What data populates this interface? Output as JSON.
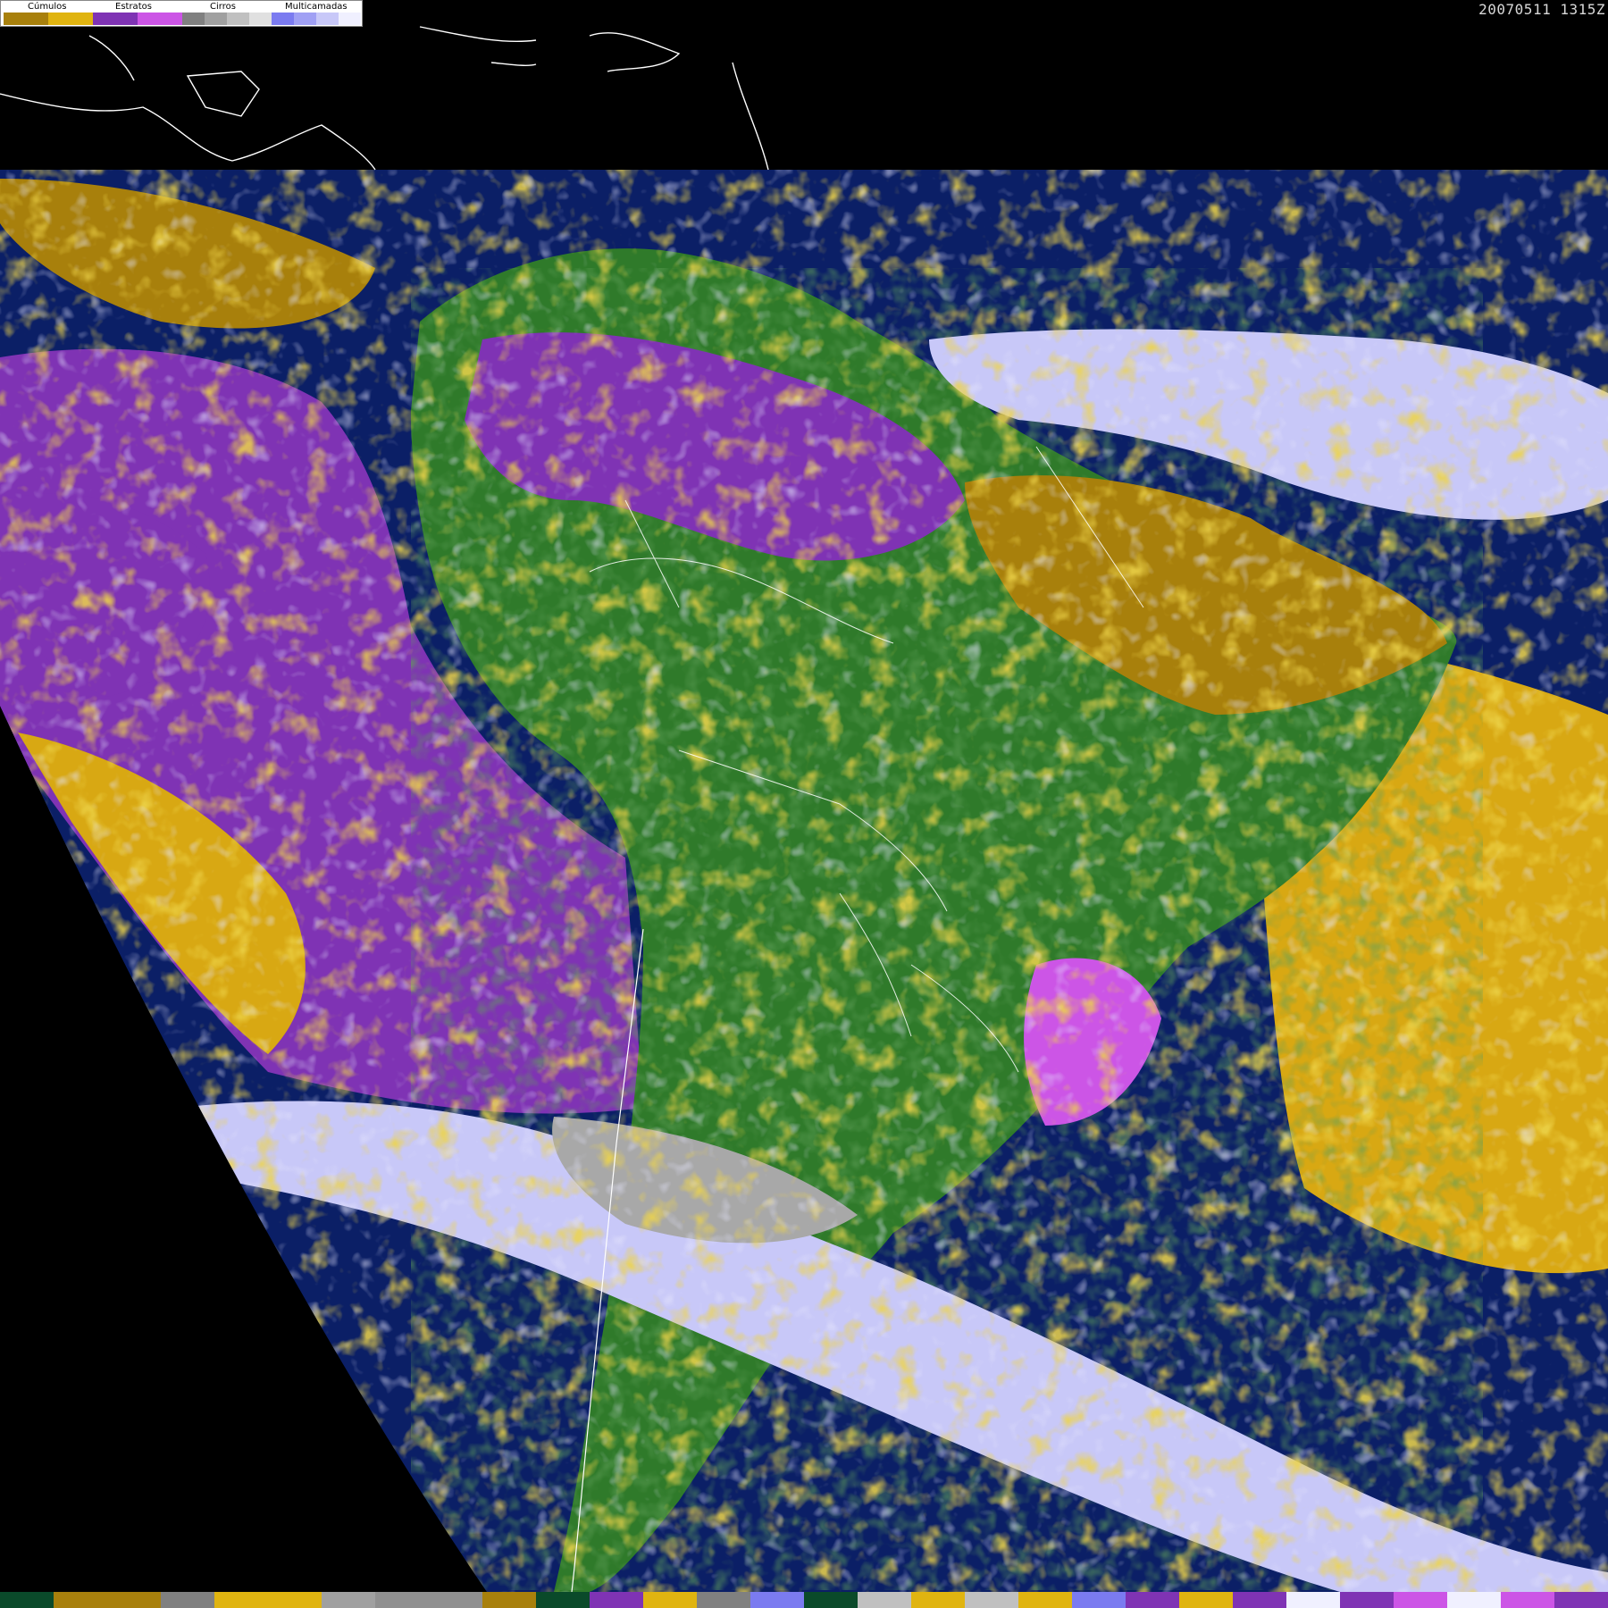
{
  "legend": {
    "groups": [
      {
        "label": "Cúmulos",
        "colors": [
          "#a8800c",
          "#e0b410"
        ]
      },
      {
        "label": "Estratos",
        "colors": [
          "#7f33b4",
          "#cc55e6"
        ]
      },
      {
        "label": "Cirros",
        "colors": [
          "#808080",
          "#a0a0a0",
          "#c0c0c0",
          "#e0e0e0"
        ]
      },
      {
        "label": "Multicamadas",
        "colors": [
          "#7b7bf0",
          "#a0a0f4",
          "#c8c8f8",
          "#f0f0ff"
        ]
      }
    ]
  },
  "timestamp": "20070511 1315Z",
  "colors": {
    "ocean": "#0b1f66",
    "land": "#2f7a2a",
    "land_dark": "#1f5a1a",
    "cumulus": "#d8a813",
    "cumulus_dark": "#a8800c",
    "stratus": "#7f33b4",
    "stratus_light": "#cc55e6",
    "cirrus": "#a8a8a8",
    "multi": "#c8c8f8",
    "border": "#ffffff"
  },
  "bottom_strip": [
    "#0a4a2a",
    "#a8800c",
    "#a8800c",
    "#808080",
    "#e0b410",
    "#e0b410",
    "#a0a0a0",
    "#909090",
    "#909090",
    "#a8800c",
    "#0a4a2a",
    "#7f33b4",
    "#e0b410",
    "#808080",
    "#7b7bf0",
    "#0a4a2a",
    "#c0c0c0",
    "#e0b410",
    "#c0c0c0",
    "#e0b410",
    "#7b7bf0",
    "#7f33b4",
    "#e0b410",
    "#7f33b4",
    "#f0f0ff",
    "#7f33b4",
    "#cc55e6",
    "#f0f0ff",
    "#cc55e6",
    "#7f33b4"
  ]
}
